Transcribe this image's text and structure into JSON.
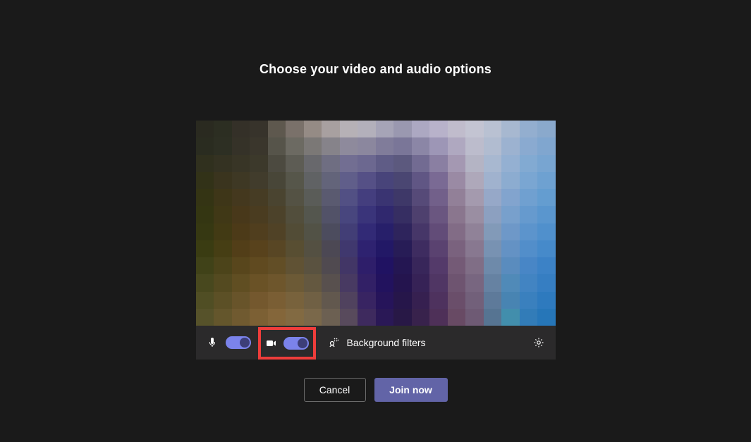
{
  "title": "Choose your video and audio options",
  "controls": {
    "mic_on": true,
    "camera_on": true,
    "background_filters_label": "Background filters"
  },
  "actions": {
    "cancel_label": "Cancel",
    "join_label": "Join now"
  },
  "colors": {
    "accent": "#6264a7",
    "toggle_on": "#7b83eb",
    "toggle_knob": "#3d3e78",
    "highlight": "#ef3d3b"
  },
  "preview_mosaic": [
    [
      "#2a2a20",
      "#2c2e22",
      "#343028",
      "#37332b",
      "#5e584e",
      "#7a716a",
      "#958b85",
      "#a8a0a0",
      "#b6b1b6",
      "#b3b0bb",
      "#a6a4b7",
      "#9a98b0",
      "#aca8c2",
      "#b8b2ca",
      "#c0bccc",
      "#c3c4d2",
      "#b9c1d2",
      "#a7b8d0",
      "#93aecf",
      "#8aa9cc"
    ],
    [
      "#2a2c20",
      "#2d2f23",
      "#353228",
      "#3a362c",
      "#56544a",
      "#6c6a62",
      "#7b7876",
      "#86838a",
      "#8e8a9c",
      "#8b879e",
      "#807c9a",
      "#7a7698",
      "#8b86a6",
      "#9d96b6",
      "#afa8c0",
      "#bcbccc",
      "#b1bcd0",
      "#9cb2d0",
      "#8aaad0",
      "#80a6cf"
    ],
    [
      "#30301e",
      "#343222",
      "#383526",
      "#3c392b",
      "#4c4a40",
      "#5d5c54",
      "#68686c",
      "#6f6e82",
      "#726e92",
      "#6c6890",
      "#5f5c86",
      "#5c597e",
      "#726b92",
      "#8a7fa2",
      "#a498b2",
      "#b4b4c4",
      "#a8b8d0",
      "#94b0d2",
      "#82aad2",
      "#78a5d1"
    ],
    [
      "#323218",
      "#3a341e",
      "#3e3824",
      "#413c2c",
      "#484638",
      "#56564a",
      "#606264",
      "#63647a",
      "#605e8a",
      "#555086",
      "#48447a",
      "#4a4672",
      "#605684",
      "#7a6a94",
      "#9a8aa4",
      "#aea8ba",
      "#a0b2ce",
      "#8cacd0",
      "#7aa6d2",
      "#6ea1d1"
    ],
    [
      "#343414",
      "#3e3618",
      "#44381e",
      "#463c24",
      "#4a4430",
      "#545244",
      "#5a5c58",
      "#5a5a70",
      "#525084",
      "#443e7e",
      "#3a3472",
      "#3e3868",
      "#564a78",
      "#72608a",
      "#928098",
      "#a49aae",
      "#96a8c8",
      "#82a4ce",
      "#70a0d0",
      "#649dd0"
    ],
    [
      "#343612",
      "#403816",
      "#48381a",
      "#4a3c20",
      "#4c422a",
      "#524e3c",
      "#54564e",
      "#525268",
      "#48467e",
      "#3a347a",
      "#30286e",
      "#362e62",
      "#4e406e",
      "#6a5680",
      "#8a768e",
      "#9a8ea2",
      "#8ca0c0",
      "#78a0cc",
      "#669ace",
      "#5a96ce"
    ],
    [
      "#363812",
      "#423a14",
      "#4c3a18",
      "#503e1e",
      "#504226",
      "#524c36",
      "#525246",
      "#4c4c5e",
      "#423e76",
      "#322a76",
      "#271f6a",
      "#2e245c",
      "#463668",
      "#624c78",
      "#826c86",
      "#908298",
      "#829ab8",
      "#6e98c8",
      "#5c94cc",
      "#5090cc"
    ],
    [
      "#3a3c12",
      "#463e14",
      "#523e18",
      "#58421c",
      "#584624",
      "#584e32",
      "#545042",
      "#4c4854",
      "#40386e",
      "#2e2270",
      "#221866",
      "#271c56",
      "#3e2c60",
      "#5a4270",
      "#7a627e",
      "#887890",
      "#7892b2",
      "#6492c4",
      "#528eca",
      "#468aca"
    ],
    [
      "#404218",
      "#4c441a",
      "#58461c",
      "#604a20",
      "#624e26",
      "#605234",
      "#5a5240",
      "#504a50",
      "#423666",
      "#2e1e6a",
      "#201262",
      "#241652",
      "#38265a",
      "#543a6a",
      "#745a76",
      "#806e86",
      "#6e8aaa",
      "#5a8cbe",
      "#4886c6",
      "#3c82c6"
    ],
    [
      "#48481e",
      "#544a20",
      "#604e22",
      "#6a5226",
      "#6e562c",
      "#6c5a36",
      "#645840",
      "#58504e",
      "#483a62",
      "#322066",
      "#22125e",
      "#24144e",
      "#362256",
      "#503664",
      "#6e5470",
      "#786680",
      "#6682a2",
      "#508ab8",
      "#4284c2",
      "#367ec2"
    ],
    [
      "#504e24",
      "#5c5026",
      "#68542a",
      "#74582e",
      "#7a5e34",
      "#78623c",
      "#706044",
      "#62584e",
      "#50425e",
      "#382462",
      "#26145a",
      "#26164a",
      "#362050",
      "#4e325e",
      "#6a4e6a",
      "#72607a",
      "#5e7a9a",
      "#4884b2",
      "#3a80be",
      "#2e7abe"
    ],
    [
      "#56522a",
      "#64562c",
      "#705a30",
      "#7c6034",
      "#84663a",
      "#826a42",
      "#7a684a",
      "#6c6052",
      "#584a5c",
      "#3e2a5e",
      "#2a1856",
      "#281846",
      "#38224c",
      "#4e3058",
      "#684a64",
      "#6e5a74",
      "#567492",
      "#428eac",
      "#327cb8",
      "#2676b8"
    ]
  ]
}
